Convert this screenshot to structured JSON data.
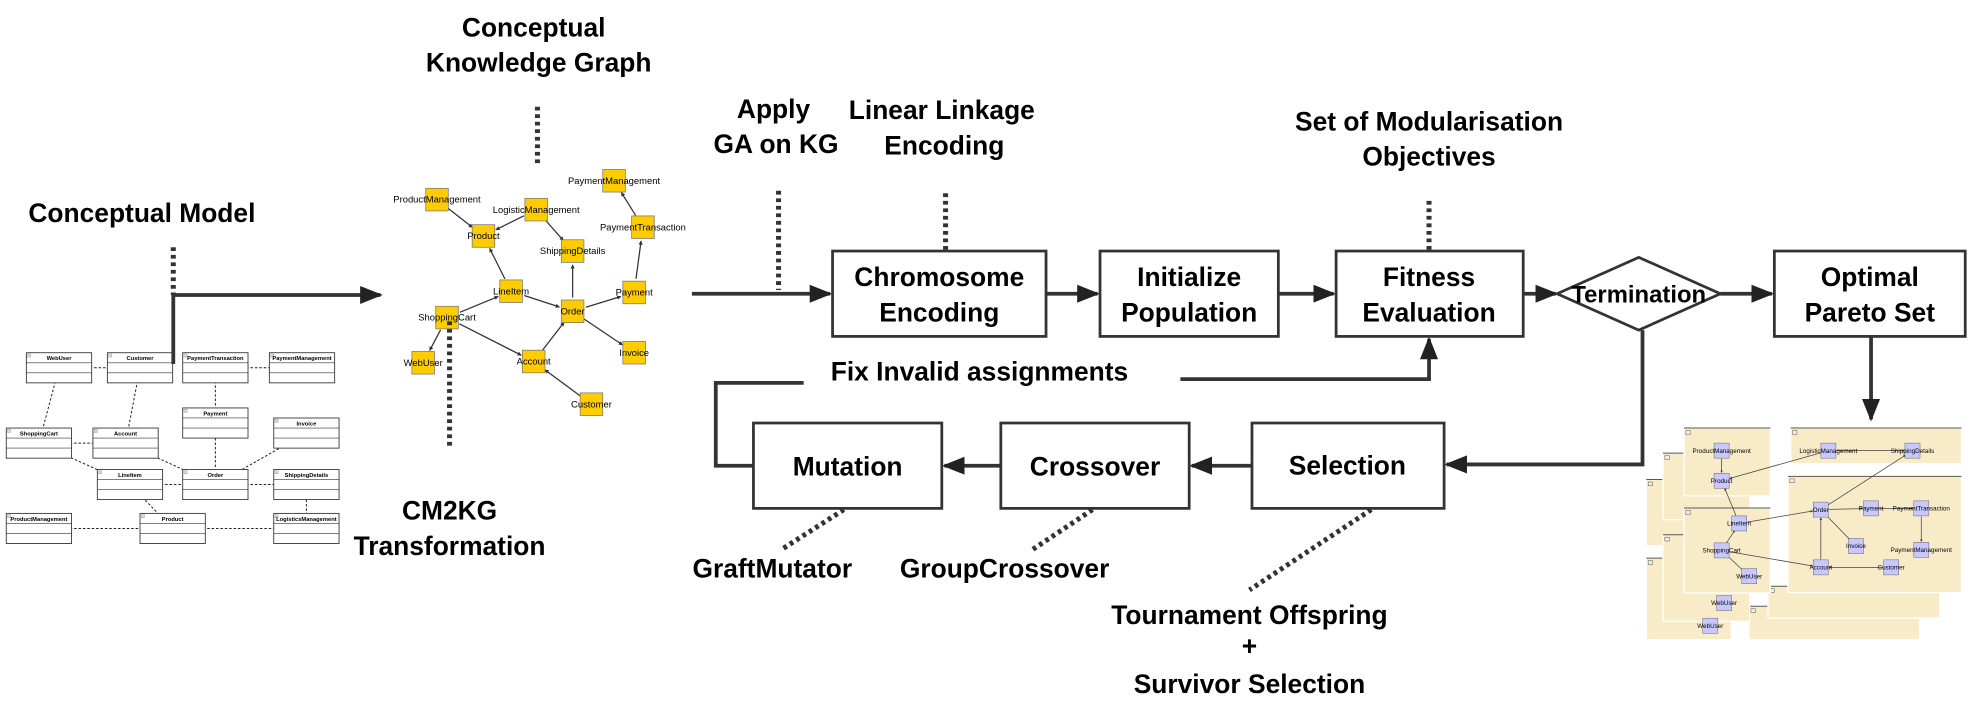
{
  "labels": {
    "conceptual_model": "Conceptual Model",
    "kg_title_1": "Conceptual",
    "kg_title_2": "Knowledge Graph",
    "cm2kg_1": "CM2KG",
    "cm2kg_2": "Transformation",
    "apply_ga_1": "Apply",
    "apply_ga_2": "GA on KG",
    "lle_1": "Linear Linkage",
    "lle_2": "Encoding",
    "objectives_1": "Set of Modularisation",
    "objectives_2": "Objectives",
    "fix_invalid": "Fix Invalid assignments",
    "graft_mutator": "GraftMutator",
    "group_crossover": "GroupCrossover",
    "tournament_1": "Tournament Offspring",
    "tournament_2": "+",
    "tournament_3": "Survivor Selection"
  },
  "steps": {
    "chromosome_1": "Chromosome",
    "chromosome_2": "Encoding",
    "init_1": "Initialize",
    "init_2": "Population",
    "fitness_1": "Fitness",
    "fitness_2": "Evaluation",
    "termination": "Termination",
    "pareto_1": "Optimal",
    "pareto_2": "Pareto Set",
    "selection": "Selection",
    "crossover": "Crossover",
    "mutation": "Mutation"
  },
  "uml_classes": [
    "WebUser",
    "Customer",
    "PaymentTransaction",
    "PaymentManagement",
    "Payment",
    "Invoice",
    "ShoppingCart",
    "Account",
    "LineItem",
    "Order",
    "ShippingDetails",
    "ProductManagement",
    "Product",
    "LogisticsManagement"
  ],
  "kg_nodes": [
    "PaymentManagement",
    "ProductManagement",
    "LogisticManagement",
    "Product",
    "PaymentTransaction",
    "ShippingDetails",
    "LineItem",
    "Payment",
    "Order",
    "ShoppingCart",
    "WebUser",
    "Account",
    "Invoice",
    "Customer"
  ],
  "pareto_nodes": [
    "ProductManagement",
    "Product",
    "LogisticManagement",
    "ShippingDetails",
    "LineItem",
    "ShoppingCart",
    "WebUser",
    "Order",
    "Payment",
    "PaymentTransaction",
    "Invoice",
    "PaymentManagement",
    "Account",
    "Customer"
  ],
  "pareto_back_labels": [
    "WebUser",
    "WebUser"
  ],
  "colors": {
    "kg_node": "#ffcc00",
    "pareto_panel": "#f8ecc8",
    "pareto_node": "#c8c8ff",
    "line": "#333333"
  }
}
